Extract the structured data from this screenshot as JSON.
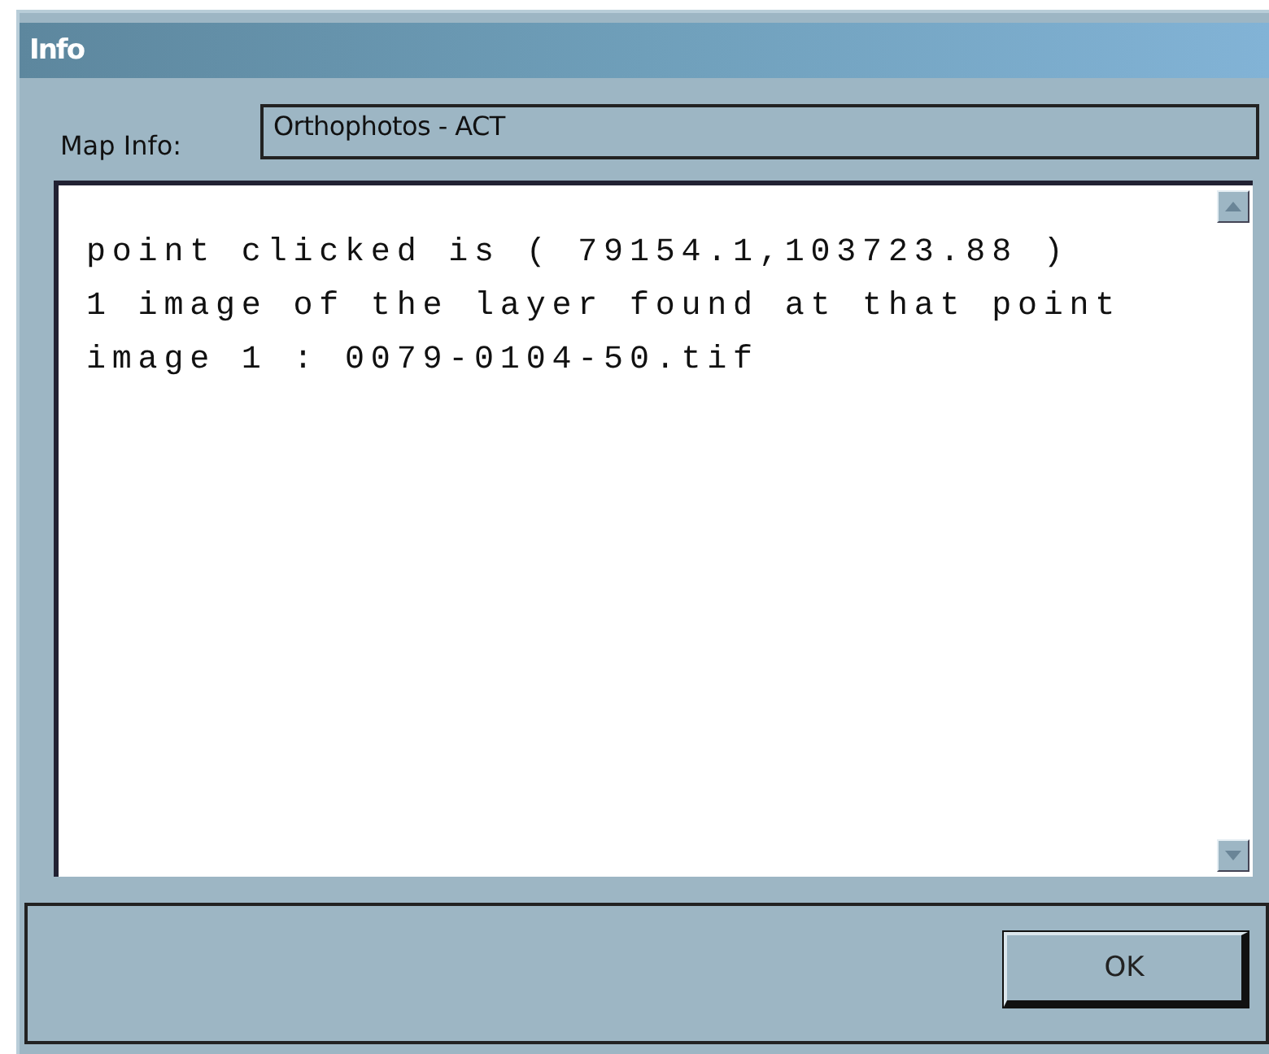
{
  "window": {
    "title": "Info"
  },
  "map_info": {
    "label": "Map Info:",
    "value": "Orthophotos - ACT"
  },
  "output": {
    "lines": [
      "point clicked is ( 79154.1,103723.88 )",
      "1 image of the layer found at that point",
      "image 1 : 0079-0104-50.tif"
    ]
  },
  "buttons": [
    {
      "label": "OK"
    }
  ]
}
